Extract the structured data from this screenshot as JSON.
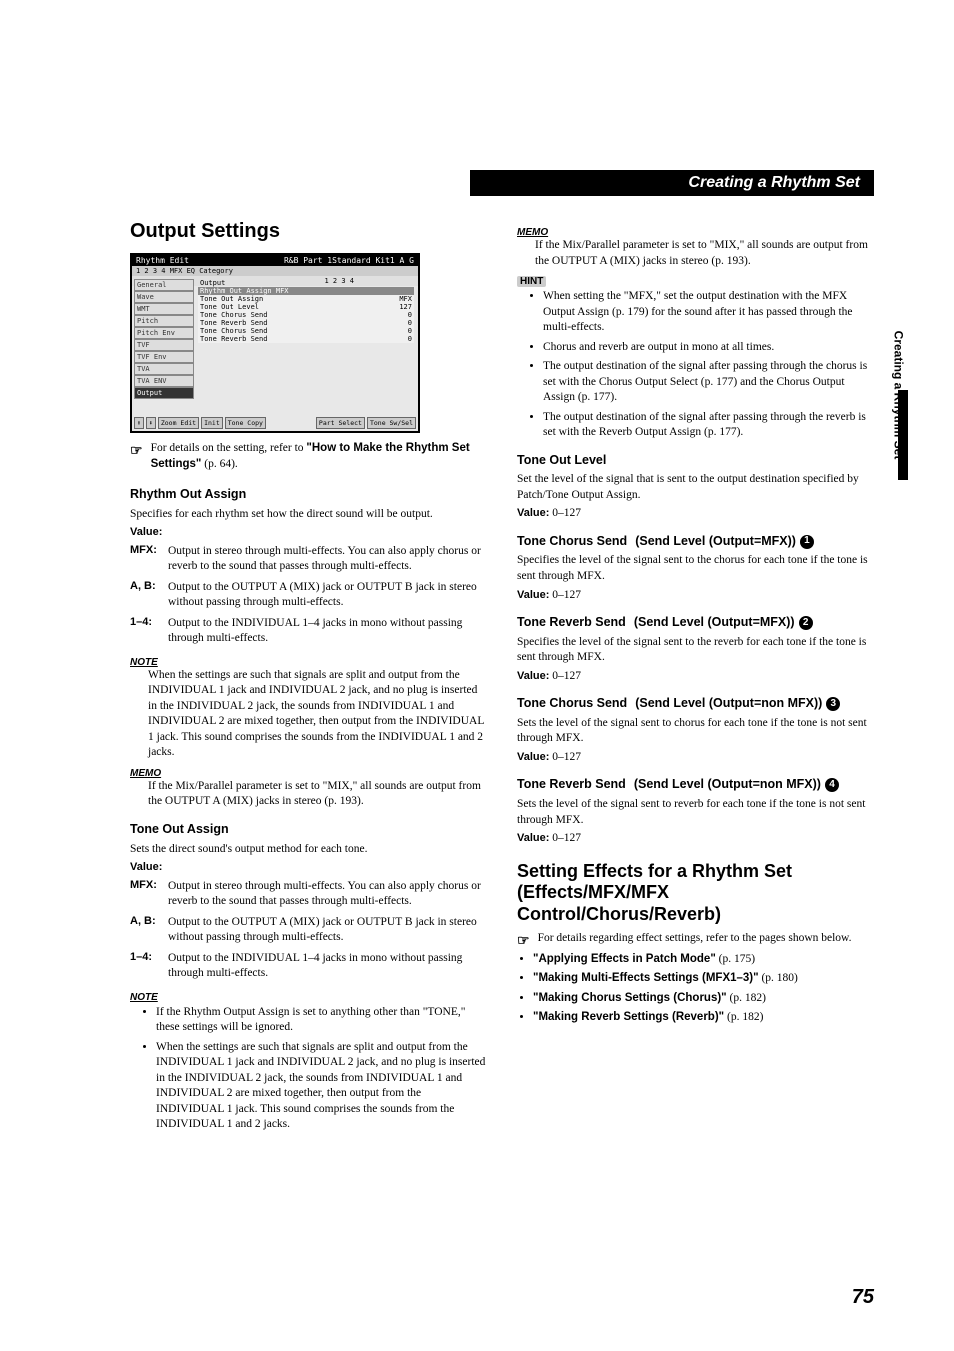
{
  "header": {
    "title": "Creating a Rhythm Set"
  },
  "sidetab": {
    "label": "Creating a Rhythm Set"
  },
  "page_number": "75",
  "left": {
    "h1": "Output Settings",
    "screenshot": {
      "title_left": "Rhythm Edit",
      "title_right": "R&B Part  1Standard Kit1 A G",
      "tabs": "1  2  3  4    MFX EQ  Category",
      "knob_row": "1   2   3   4",
      "sidebar": [
        "General",
        "Wave",
        "WMT",
        "Pitch",
        "Pitch Env",
        "TVF",
        "TVF Env",
        "TVA",
        "TVA ENV",
        "Output"
      ],
      "lcd_header": "Output",
      "group": "Rhythm Out Assign                         MFX",
      "rows": [
        {
          "l": "Tone Out Assign",
          "r": "MFX"
        },
        {
          "l": "Tone Out Level",
          "r": "127"
        },
        {
          "l": "Tone Chorus Send",
          "r": "0"
        },
        {
          "l": "Tone Reverb Send",
          "r": "0"
        },
        {
          "l": "Tone Chorus Send",
          "r": "0"
        },
        {
          "l": "Tone Reverb Send",
          "r": "0"
        }
      ],
      "buttons": [
        "⬆",
        "⬇",
        "Zoom Edit",
        "Init",
        "Tone Copy",
        "",
        "Part Select",
        "Tone Sw/Sel"
      ]
    },
    "ref_intro": "For details on the setting, refer to ",
    "ref_bold": "\"How to Make the Rhythm Set Settings\"",
    "ref_page": " (p. 64).",
    "rhythm_out": {
      "h": "Rhythm Out Assign",
      "p1": "Specifies for each rhythm set how the direct sound will be output.",
      "value": "Value:",
      "defs": [
        {
          "t": "MFX:",
          "d": "Output in stereo through multi-effects. You can also apply chorus or reverb to the sound that passes through multi-effects."
        },
        {
          "t": "A, B:",
          "d": "Output to the OUTPUT A (MIX) jack or OUTPUT B jack in stereo without passing through multi-effects."
        },
        {
          "t": "1–4:",
          "d": "Output to the INDIVIDUAL 1–4 jacks in mono without passing through multi-effects."
        }
      ],
      "note": "When the settings are such that signals are split and output from the INDIVIDUAL 1 jack and INDIVIDUAL 2 jack, and no plug is inserted in the INDIVIDUAL 2 jack, the sounds from INDIVIDUAL 1 and INDIVIDUAL 2 are mixed together, then output from the INDIVIDUAL 1 jack. This sound comprises the sounds from the INDIVIDUAL 1 and 2 jacks.",
      "memo": "If the Mix/Parallel parameter is set to \"MIX,\" all sounds are output from the OUTPUT A (MIX) jacks in stereo (p. 193)."
    },
    "tone_out_assign": {
      "h": "Tone Out Assign",
      "p1": "Sets the direct sound's output method for each tone.",
      "value": "Value:",
      "defs": [
        {
          "t": "MFX:",
          "d": "Output in stereo through multi-effects. You can also apply chorus or reverb to the sound that passes through multi-effects."
        },
        {
          "t": "A, B:",
          "d": "Output to the OUTPUT A (MIX) jack or OUTPUT B jack in stereo without passing through multi-effects."
        },
        {
          "t": "1–4:",
          "d": "Output to the INDIVIDUAL 1–4 jacks in mono without passing through multi-effects."
        }
      ],
      "note_bullets": [
        "If the Rhythm Output Assign is set to anything other than \"TONE,\" these settings will be ignored.",
        "When the settings are such that signals are split and output from the INDIVIDUAL 1 jack and INDIVIDUAL 2 jack, and no plug is inserted in the INDIVIDUAL 2 jack, the sounds from INDIVIDUAL 1 and INDIVIDUAL 2 are mixed together, then output from the INDIVIDUAL 1 jack. This sound comprises the sounds from the INDIVIDUAL 1 and 2 jacks."
      ]
    }
  },
  "right": {
    "memo": "If the Mix/Parallel parameter is set to \"MIX,\" all sounds are output from the OUTPUT A (MIX) jacks in stereo (p. 193).",
    "hint_bullets": [
      "When setting the \"MFX,\" set the output destination with the MFX Output Assign (p. 179) for the sound after it has passed through the multi-effects.",
      "Chorus and reverb are output in mono at all times.",
      "The output destination of the signal after passing through the chorus is set with the Chorus Output Select (p. 177) and the Chorus Output Assign (p. 177).",
      "The output destination of the signal after passing through the reverb is set with the Reverb Output Assign (p. 177)."
    ],
    "tone_out_level": {
      "h": "Tone Out Level",
      "p": "Set the level of the signal that is sent to the output destination specified by Patch/Tone Output Assign.",
      "v_label": "Value:",
      "v": " 0–127"
    },
    "tone_chorus_mfx": {
      "h1": "Tone Chorus Send",
      "h2": "(Send Level (Output=MFX))",
      "num": "1",
      "p": "Specifies the level of the signal sent to the chorus for each tone if the tone is sent through MFX.",
      "v_label": "Value:",
      "v": " 0–127"
    },
    "tone_reverb_mfx": {
      "h1": "Tone Reverb Send",
      "h2": "(Send Level (Output=MFX))",
      "num": "2",
      "p": "Specifies the level of the signal sent to the reverb for each tone if the tone is sent through MFX.",
      "v_label": "Value:",
      "v": " 0–127"
    },
    "tone_chorus_non": {
      "h1": "Tone Chorus Send",
      "h2": "(Send Level (Output=non MFX))",
      "num": "3",
      "p": "Sets the level of the signal sent to chorus for each tone if the tone is not sent through MFX.",
      "v_label": "Value:",
      "v": " 0–127"
    },
    "tone_reverb_non": {
      "h1": "Tone Reverb Send",
      "h2": "(Send Level (Output=non MFX))",
      "num": "4",
      "p": "Sets the level of the signal sent to reverb for each tone if the tone is not sent through MFX.",
      "v_label": "Value:",
      "v": " 0–127"
    },
    "effects": {
      "h": "Setting Effects for a Rhythm Set (Effects/MFX/MFX Control/Chorus/Reverb)",
      "ref": "For details regarding effect settings, refer to the pages shown below.",
      "links": [
        {
          "t": "\"Applying Effects in Patch Mode\"",
          "p": " (p. 175)"
        },
        {
          "t": "\"Making Multi-Effects Settings (MFX1–3)\"",
          "p": " (p. 180)"
        },
        {
          "t": "\"Making Chorus Settings (Chorus)\"",
          "p": " (p. 182)"
        },
        {
          "t": "\"Making Reverb Settings (Reverb)\"",
          "p": " (p. 182)"
        }
      ]
    }
  },
  "icons": {
    "memo": "MEMO",
    "note": "NOTE",
    "hint": "HINT",
    "pointer": "☞"
  }
}
